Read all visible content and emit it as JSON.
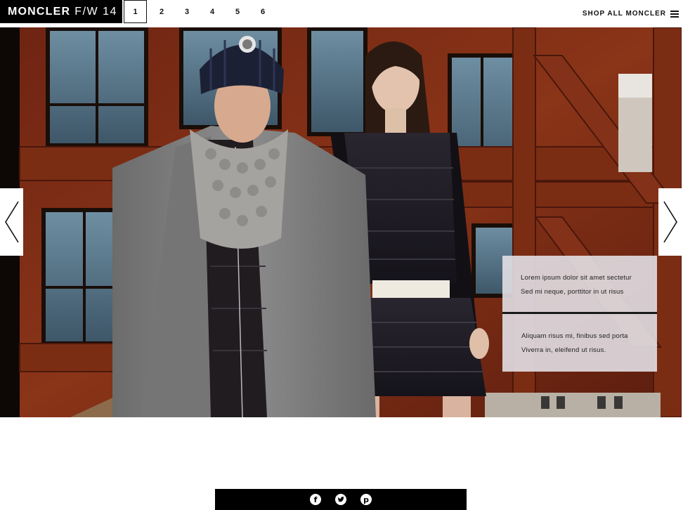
{
  "header": {
    "brand": "MONCLER",
    "season": "F/W 14",
    "pages": [
      "1",
      "2",
      "3",
      "4",
      "5",
      "6"
    ],
    "active_page": "1",
    "shop_all": "SHOP ALL MONCLER",
    "menu_icon": "hamburger-icon"
  },
  "hero": {
    "prev_icon": "chevron-left-icon",
    "next_icon": "chevron-right-icon",
    "caption": {
      "line1": "Lorem ipsum dolor sit amet sectetur",
      "line2": "Sed mi neque, porttitor in ut risus",
      "line3": "Aliquam risus mi, finibus sed porta",
      "line4": "Viverra in, eleifend ut risus."
    }
  },
  "social": {
    "icons": [
      "facebook-icon",
      "twitter-icon",
      "pinterest-icon"
    ]
  },
  "colors": {
    "header_bg": "#000000",
    "building": "#7a2a14",
    "caption_bg": "#e2dfe4"
  }
}
